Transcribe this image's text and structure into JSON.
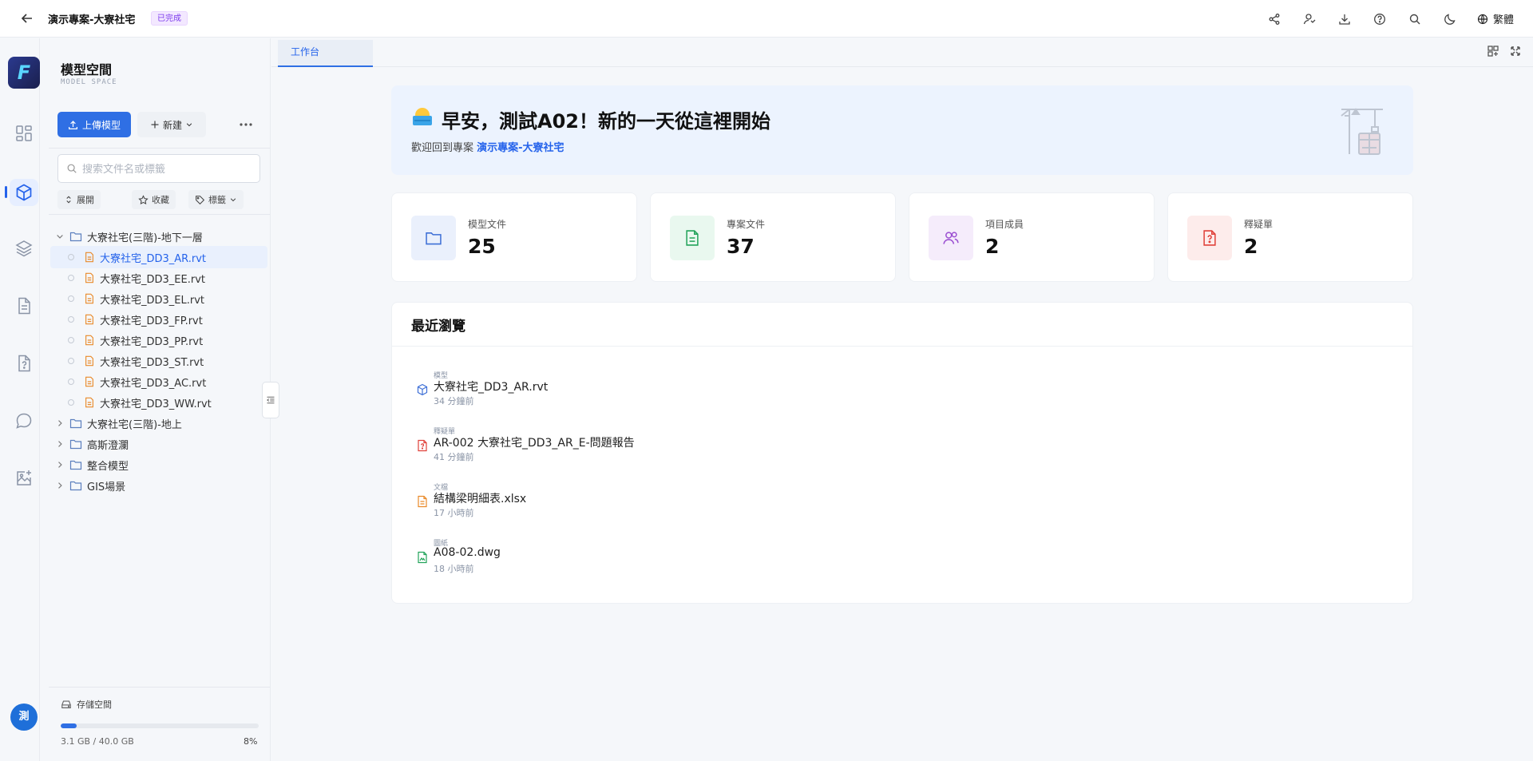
{
  "header": {
    "project_title": "演示專案-大寮社宅",
    "status_badge": "已完成",
    "language": "繁體",
    "icons": [
      "share-icon",
      "user-manage-icon",
      "download-icon",
      "help-icon",
      "search-icon",
      "dark-mode-icon",
      "globe-icon"
    ]
  },
  "rail": {
    "avatar_initial": "測",
    "items": [
      "dashboard-icon",
      "model-cube-icon",
      "layers-icon",
      "document-icon",
      "issue-icon",
      "chat-icon",
      "image-add-icon"
    ]
  },
  "sidebar": {
    "title": "模型空間",
    "subtitle": "MODEL SPACE",
    "upload_label": "上傳模型",
    "new_label": "新建",
    "search_placeholder": "搜索文件名或標籤",
    "chips": {
      "expand": "展開",
      "favorite": "收藏",
      "tags": "標籤"
    },
    "tree": {
      "folder_expanded": "大寮社宅(三階)-地下一層",
      "files": [
        "大寮社宅_DD3_AR.rvt",
        "大寮社宅_DD3_EE.rvt",
        "大寮社宅_DD3_EL.rvt",
        "大寮社宅_DD3_FP.rvt",
        "大寮社宅_DD3_PP.rvt",
        "大寮社宅_DD3_ST.rvt",
        "大寮社宅_DD3_AC.rvt",
        "大寮社宅_DD3_WW.rvt"
      ],
      "folders": [
        "大寮社宅(三階)-地上",
        "高斯澄瀾",
        "整合模型",
        "GIS場景"
      ]
    },
    "storage": {
      "label": "存儲空間",
      "used": "3.1 GB / 40.0 GB",
      "percent_text": "8%",
      "percent": 8
    }
  },
  "tabs": {
    "workbench": "工作台"
  },
  "welcome": {
    "title": "早安，測試A02！新的一天從這裡開始",
    "sub_prefix": "歡迎回到專案",
    "project": "演示專案-大寮社宅"
  },
  "stats": [
    {
      "label": "模型文件",
      "value": "25"
    },
    {
      "label": "專案文件",
      "value": "37"
    },
    {
      "label": "項目成員",
      "value": "2"
    },
    {
      "label": "釋疑單",
      "value": "2"
    }
  ],
  "recent": {
    "title": "最近瀏覽",
    "items": [
      {
        "type": "模型",
        "name": "大寮社宅_DD3_AR.rvt",
        "time": "34 分鐘前"
      },
      {
        "type": "釋疑單",
        "name": "AR-002 大寮社宅_DD3_AR_E-問題報告",
        "time": "41 分鐘前"
      },
      {
        "type": "文檔",
        "name": "結構梁明細表.xlsx",
        "time": "17 小時前"
      },
      {
        "type": "圖紙",
        "name": "A08-02.dwg",
        "time": "18 小時前"
      }
    ]
  },
  "colors": {
    "accent": "#2f6fe4",
    "folder": "#5b7fbe",
    "file": "#e98a2a"
  }
}
